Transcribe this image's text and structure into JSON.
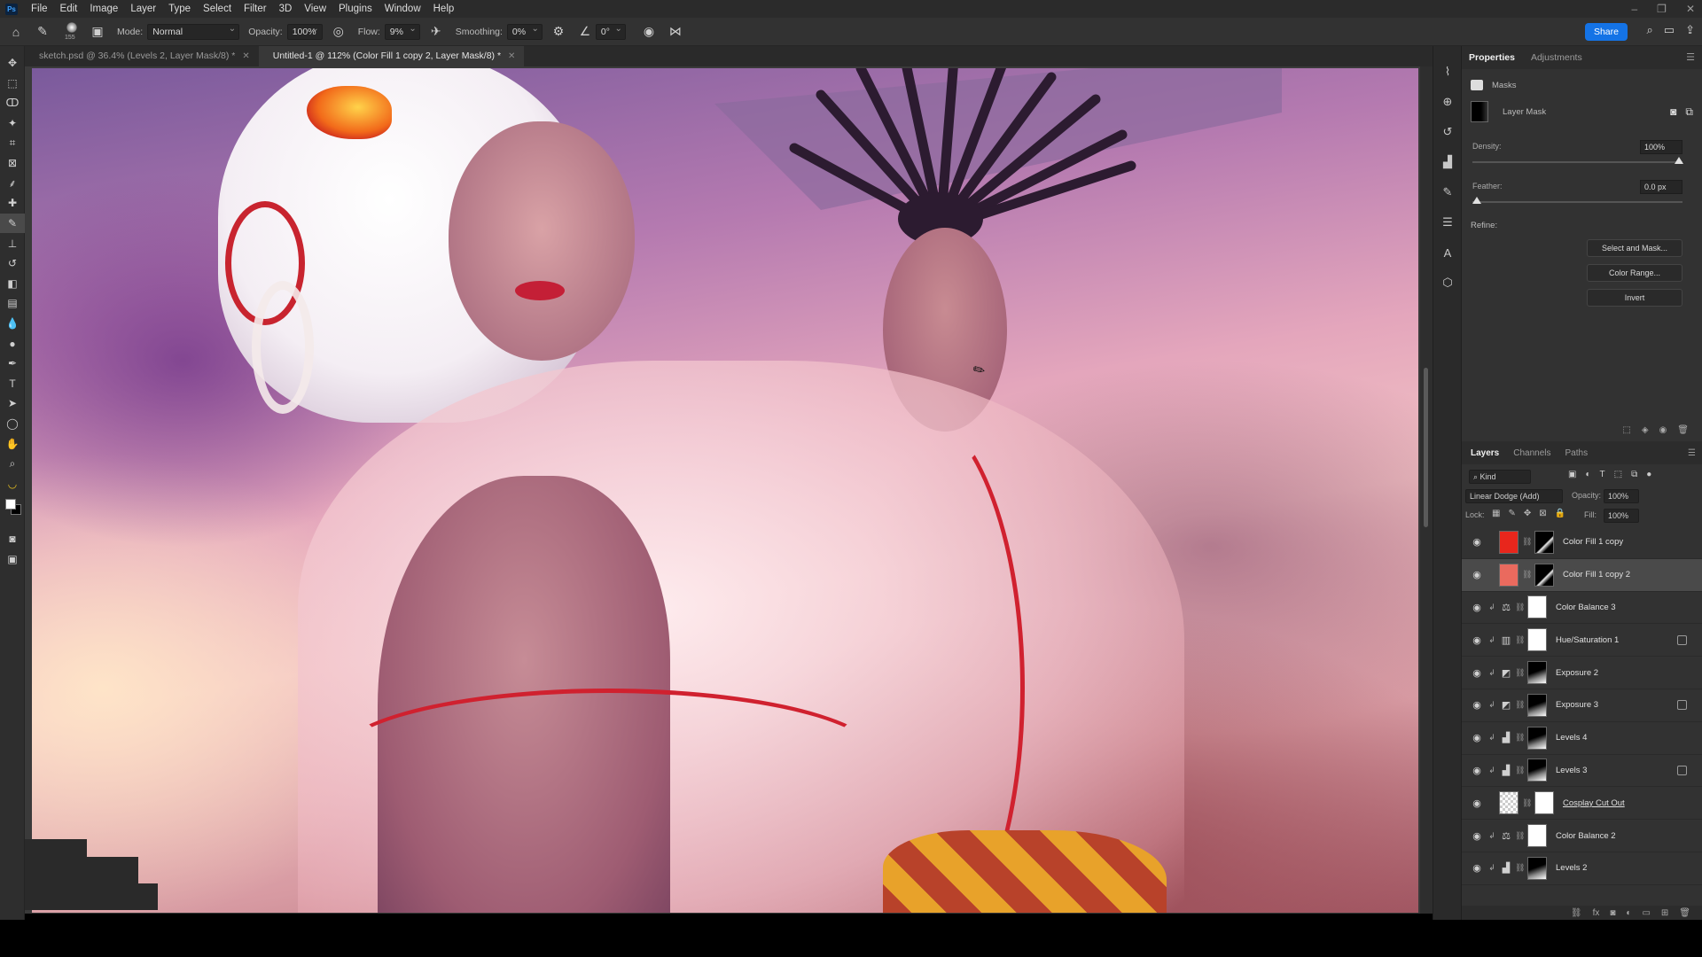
{
  "menubar": {
    "logo": "Ps",
    "items": [
      "File",
      "Edit",
      "Image",
      "Layer",
      "Type",
      "Select",
      "Filter",
      "3D",
      "View",
      "Plugins",
      "Window",
      "Help"
    ]
  },
  "options": {
    "brush_size": "155",
    "mode_label": "Mode:",
    "mode_value": "Normal",
    "opacity_label": "Opacity:",
    "opacity_value": "100%",
    "flow_label": "Flow:",
    "flow_value": "9%",
    "smoothing_label": "Smoothing:",
    "smoothing_value": "0%",
    "angle_value": "0°",
    "share_label": "Share"
  },
  "tabs": [
    {
      "label": "sketch.psd @ 36.4% (Levels 2, Layer Mask/8) *"
    },
    {
      "label": "Untitled-1 @ 112% (Color Fill 1 copy 2, Layer Mask/8) *"
    }
  ],
  "properties": {
    "tabs": [
      "Properties",
      "Adjustments"
    ],
    "section": "Masks",
    "mask_label": "Layer Mask",
    "density_label": "Density:",
    "density_value": "100%",
    "density": 1.0,
    "feather_label": "Feather:",
    "feather_value": "0.0 px",
    "feather": 0.0,
    "refine_label": "Refine:",
    "btn_select_mask": "Select and Mask...",
    "btn_color_range": "Color Range...",
    "btn_invert": "Invert"
  },
  "layers_panel": {
    "tabs": [
      "Layers",
      "Channels",
      "Paths"
    ],
    "kind_label": "Kind",
    "blend_mode": "Linear Dodge (Add)",
    "opacity_label": "Opacity:",
    "opacity_value": "100%",
    "lock_label": "Lock:",
    "fill_label": "Fill:",
    "fill_value": "100%",
    "layers": [
      {
        "name": "Color Fill 1 copy",
        "type": "fill",
        "color": "#e8261c",
        "clipped": false,
        "selected": false,
        "underlined": false
      },
      {
        "name": "Color Fill 1 copy 2",
        "type": "fill",
        "color": "#ea6a5e",
        "clipped": false,
        "selected": true,
        "underlined": false
      },
      {
        "name": "Color Balance 3",
        "type": "balance",
        "clipped": true,
        "selected": false,
        "underlined": false
      },
      {
        "name": "Hue/Saturation 1",
        "type": "huesat",
        "clipped": true,
        "selected": false,
        "underlined": false
      },
      {
        "name": "Exposure 2",
        "type": "exposure",
        "clipped": true,
        "selected": false,
        "underlined": false
      },
      {
        "name": "Exposure 3",
        "type": "exposure",
        "clipped": true,
        "selected": false,
        "underlined": false
      },
      {
        "name": "Levels 4",
        "type": "levels",
        "clipped": true,
        "selected": false,
        "underlined": false
      },
      {
        "name": "Levels 3",
        "type": "levels",
        "clipped": true,
        "selected": false,
        "underlined": false
      },
      {
        "name": "Cosplay Cut Out",
        "type": "smart",
        "clipped": false,
        "selected": false,
        "underlined": true
      },
      {
        "name": "Color Balance 2",
        "type": "balance",
        "clipped": true,
        "selected": false,
        "underlined": false
      },
      {
        "name": "Levels 2",
        "type": "levels",
        "clipped": true,
        "selected": false,
        "underlined": false
      }
    ]
  }
}
